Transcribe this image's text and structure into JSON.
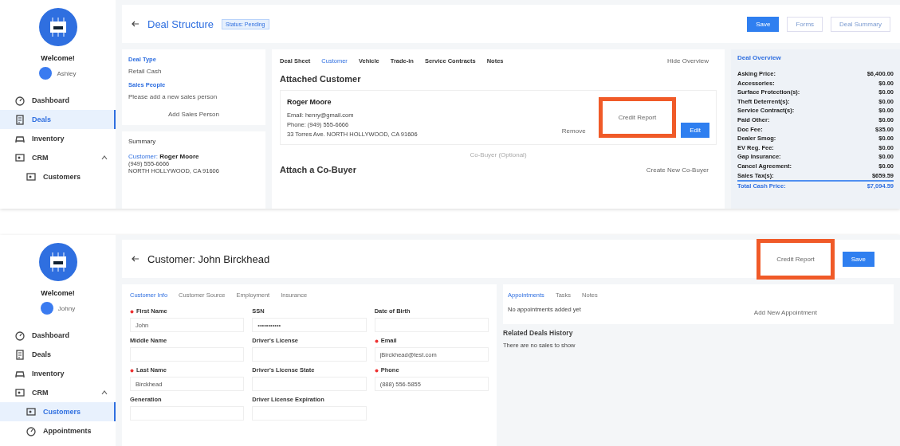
{
  "deal_screen": {
    "sidebar": {
      "welcome": "Welcome!",
      "user": "Ashley",
      "items": [
        {
          "label": "Dashboard",
          "selected": false
        },
        {
          "label": "Deals",
          "selected": true
        },
        {
          "label": "Inventory",
          "selected": false
        },
        {
          "label": "CRM",
          "selected": false,
          "expanded": true,
          "children": [
            {
              "label": "Customers",
              "selected": false
            }
          ]
        }
      ]
    },
    "header": {
      "title": "Deal Structure",
      "badge": "Status: Pending",
      "buttons": [
        {
          "label": "Save",
          "kind": "primary"
        },
        {
          "label": "Forms",
          "kind": "plain"
        },
        {
          "label": "Deal Summary",
          "kind": "plain"
        }
      ]
    },
    "deal_type": {
      "label": "Deal Type",
      "value": "Retail Cash"
    },
    "sales_people": {
      "label": "Sales People",
      "message": "Please add a new sales person",
      "button": "Add Sales Person"
    },
    "summary": {
      "title": "Summary",
      "customer": "Customer: **Roger Moore**",
      "phone": "(949) 555-6666",
      "address": "NORTH HOLLYWOOD, CA 91606"
    },
    "tabs": [
      {
        "label": "Deal Sheet",
        "selected": false
      },
      {
        "label": "Customer",
        "selected": true
      },
      {
        "label": "Vehicle",
        "selected": false
      },
      {
        "label": "Trade-in",
        "selected": false
      },
      {
        "label": "Service Contracts",
        "selected": false
      },
      {
        "label": "Notes",
        "selected": false
      }
    ],
    "hide_overview": "Hide Overview",
    "attached_customer": {
      "heading": "Attached Customer",
      "name": "Roger Moore",
      "email": "Email: henry@gmail.com",
      "phone": "Phone: (949) 555-6666",
      "address": "33 Torres Ave. NORTH HOLLYWOOD, CA 91606",
      "actions": [
        {
          "label": "Remove",
          "kind": "link",
          "highlighted": false
        },
        {
          "label": "Credit Report",
          "kind": "link",
          "highlighted": true
        },
        {
          "label": "Edit",
          "kind": "primary",
          "highlighted": false
        }
      ]
    },
    "co_buyer": {
      "label": "Co-Buyer (Optional)",
      "heading": "Attach a Co-Buyer",
      "button": "Create New Co-Buyer"
    },
    "overview": {
      "title": "Deal Overview",
      "rows": [
        {
          "label": "Asking Price:",
          "value": "$6,400.00",
          "kind": "line"
        },
        {
          "label": "Accessories:",
          "value": "$0.00",
          "kind": "line"
        },
        {
          "label": "Surface Protection(s):",
          "value": "$0.00",
          "kind": "line"
        },
        {
          "label": "Theft Deterrent(s):",
          "value": "$0.00",
          "kind": "line"
        },
        {
          "label": "Service Contract(s):",
          "value": "$0.00",
          "kind": "line"
        },
        {
          "label": "Paid Other:",
          "value": "$0.00",
          "kind": "line"
        },
        {
          "label": "Doc Fee:",
          "value": "$35.00",
          "kind": "line"
        },
        {
          "label": "Dealer Smog:",
          "value": "$0.00",
          "kind": "line"
        },
        {
          "label": "EV Reg. Fee:",
          "value": "$0.00",
          "kind": "line"
        },
        {
          "label": "Gap Insurance:",
          "value": "$0.00",
          "kind": "line"
        },
        {
          "label": "Cancel Agreement:",
          "value": "$0.00",
          "kind": "line"
        },
        {
          "label": "Sales Tax(s):",
          "value": "$659.59",
          "kind": "line"
        },
        {
          "label": "Total Cash Price:",
          "value": "$7,094.59",
          "kind": "total"
        }
      ]
    }
  },
  "customer_screen": {
    "sidebar": {
      "welcome": "Welcome!",
      "user": "Johny",
      "items": [
        {
          "label": "Dashboard",
          "selected": false
        },
        {
          "label": "Deals",
          "selected": false
        },
        {
          "label": "Inventory",
          "selected": false
        },
        {
          "label": "CRM",
          "selected": false,
          "expanded": true,
          "children": [
            {
              "label": "Customers",
              "selected": true
            },
            {
              "label": "Appointments",
              "selected": false
            }
          ]
        }
      ]
    },
    "header": {
      "title": "Customer: John Birckhead",
      "actions": [
        {
          "label": "Credit Report",
          "kind": "link",
          "highlighted": true
        },
        {
          "label": "Save",
          "kind": "primary",
          "highlighted": false
        }
      ]
    },
    "tabs": [
      {
        "label": "Customer Info",
        "selected": true
      },
      {
        "label": "Customer Source",
        "selected": false
      },
      {
        "label": "Employment",
        "selected": false
      },
      {
        "label": "Insurance",
        "selected": false
      }
    ],
    "fields": [
      {
        "label": "First Name",
        "required": true,
        "value": "John"
      },
      {
        "label": "SSN",
        "required": false,
        "value": "•••••••••••"
      },
      {
        "label": "Date of Birth",
        "required": false
      },
      {
        "label": "Middle Name",
        "required": false
      },
      {
        "label": "Driver's License",
        "required": false
      },
      {
        "label": "Email",
        "required": true,
        "value": "jBirckhead@test.com"
      },
      {
        "label": "Last Name",
        "required": true,
        "value": "Birckhead"
      },
      {
        "label": "Driver's License State",
        "required": false
      },
      {
        "label": "Phone",
        "required": true,
        "value": "(888) 556-5855"
      },
      {
        "label": "Generation",
        "required": false
      },
      {
        "label": "Driver License Expiration",
        "required": false
      }
    ],
    "side_tabs": [
      {
        "label": "Appointments",
        "selected": true
      },
      {
        "label": "Tasks",
        "selected": false
      },
      {
        "label": "Notes",
        "selected": false
      }
    ],
    "appointments": {
      "empty": "No appointments added yet",
      "button": "Add New Appointment"
    },
    "related": {
      "heading": "Related Deals History",
      "empty": "There are no sales to show"
    }
  }
}
